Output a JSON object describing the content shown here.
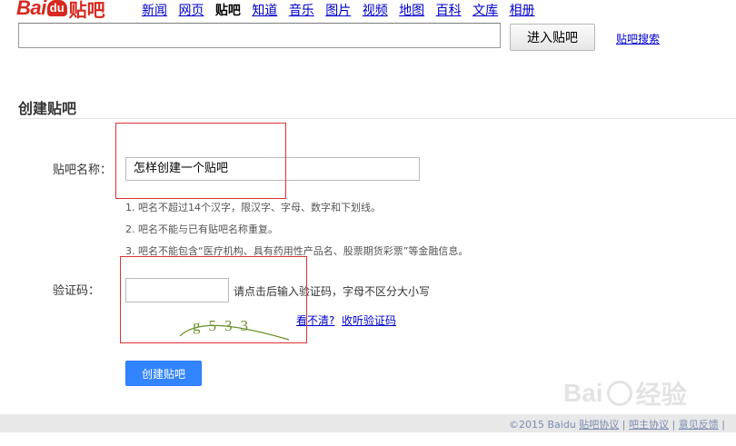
{
  "logo": {
    "brand_latin": "Bai",
    "brand_paw": "du",
    "brand_cn": "贴吧"
  },
  "nav": {
    "items": [
      "新闻",
      "网页",
      "贴吧",
      "知道",
      "音乐",
      "图片",
      "视频",
      "地图",
      "百科",
      "文库",
      "相册"
    ],
    "active": "贴吧"
  },
  "search": {
    "value": "",
    "button_label": "进入贴吧",
    "link_label": "贴吧搜索"
  },
  "page": {
    "title": "创建贴吧"
  },
  "form": {
    "name_label": "贴吧名称：",
    "name_value": "怎样创建一个贴吧",
    "rules": [
      "1. 吧名不超过14个汉字，限汉字、字母、数字和下划线。",
      "2. 吧名不能与已有贴吧名称重复。",
      "3. 吧名不能包含“医疗机构、具有药用性产品名、股票期货彩票”等金融信息。"
    ],
    "captcha_label": "验证码：",
    "captcha_value": "",
    "captcha_hint": "请点击后输入验证码，字母不区分大小写",
    "captcha_image_text": "g533",
    "unclear_link": "看不清?",
    "listen_link": "收听验证码",
    "submit_label": "创建贴吧"
  },
  "footer": {
    "copyright": "©2015 Baidu",
    "links": [
      "贴吧协议",
      "吧主协议",
      "意见反馈"
    ]
  },
  "watermark": {
    "text": "Bai",
    "text_cn": "经验"
  },
  "colors": {
    "brand_red": "#d8281f",
    "link_blue": "#0000cc",
    "button_blue": "#3385ff",
    "highlight_red": "#dd3333"
  }
}
